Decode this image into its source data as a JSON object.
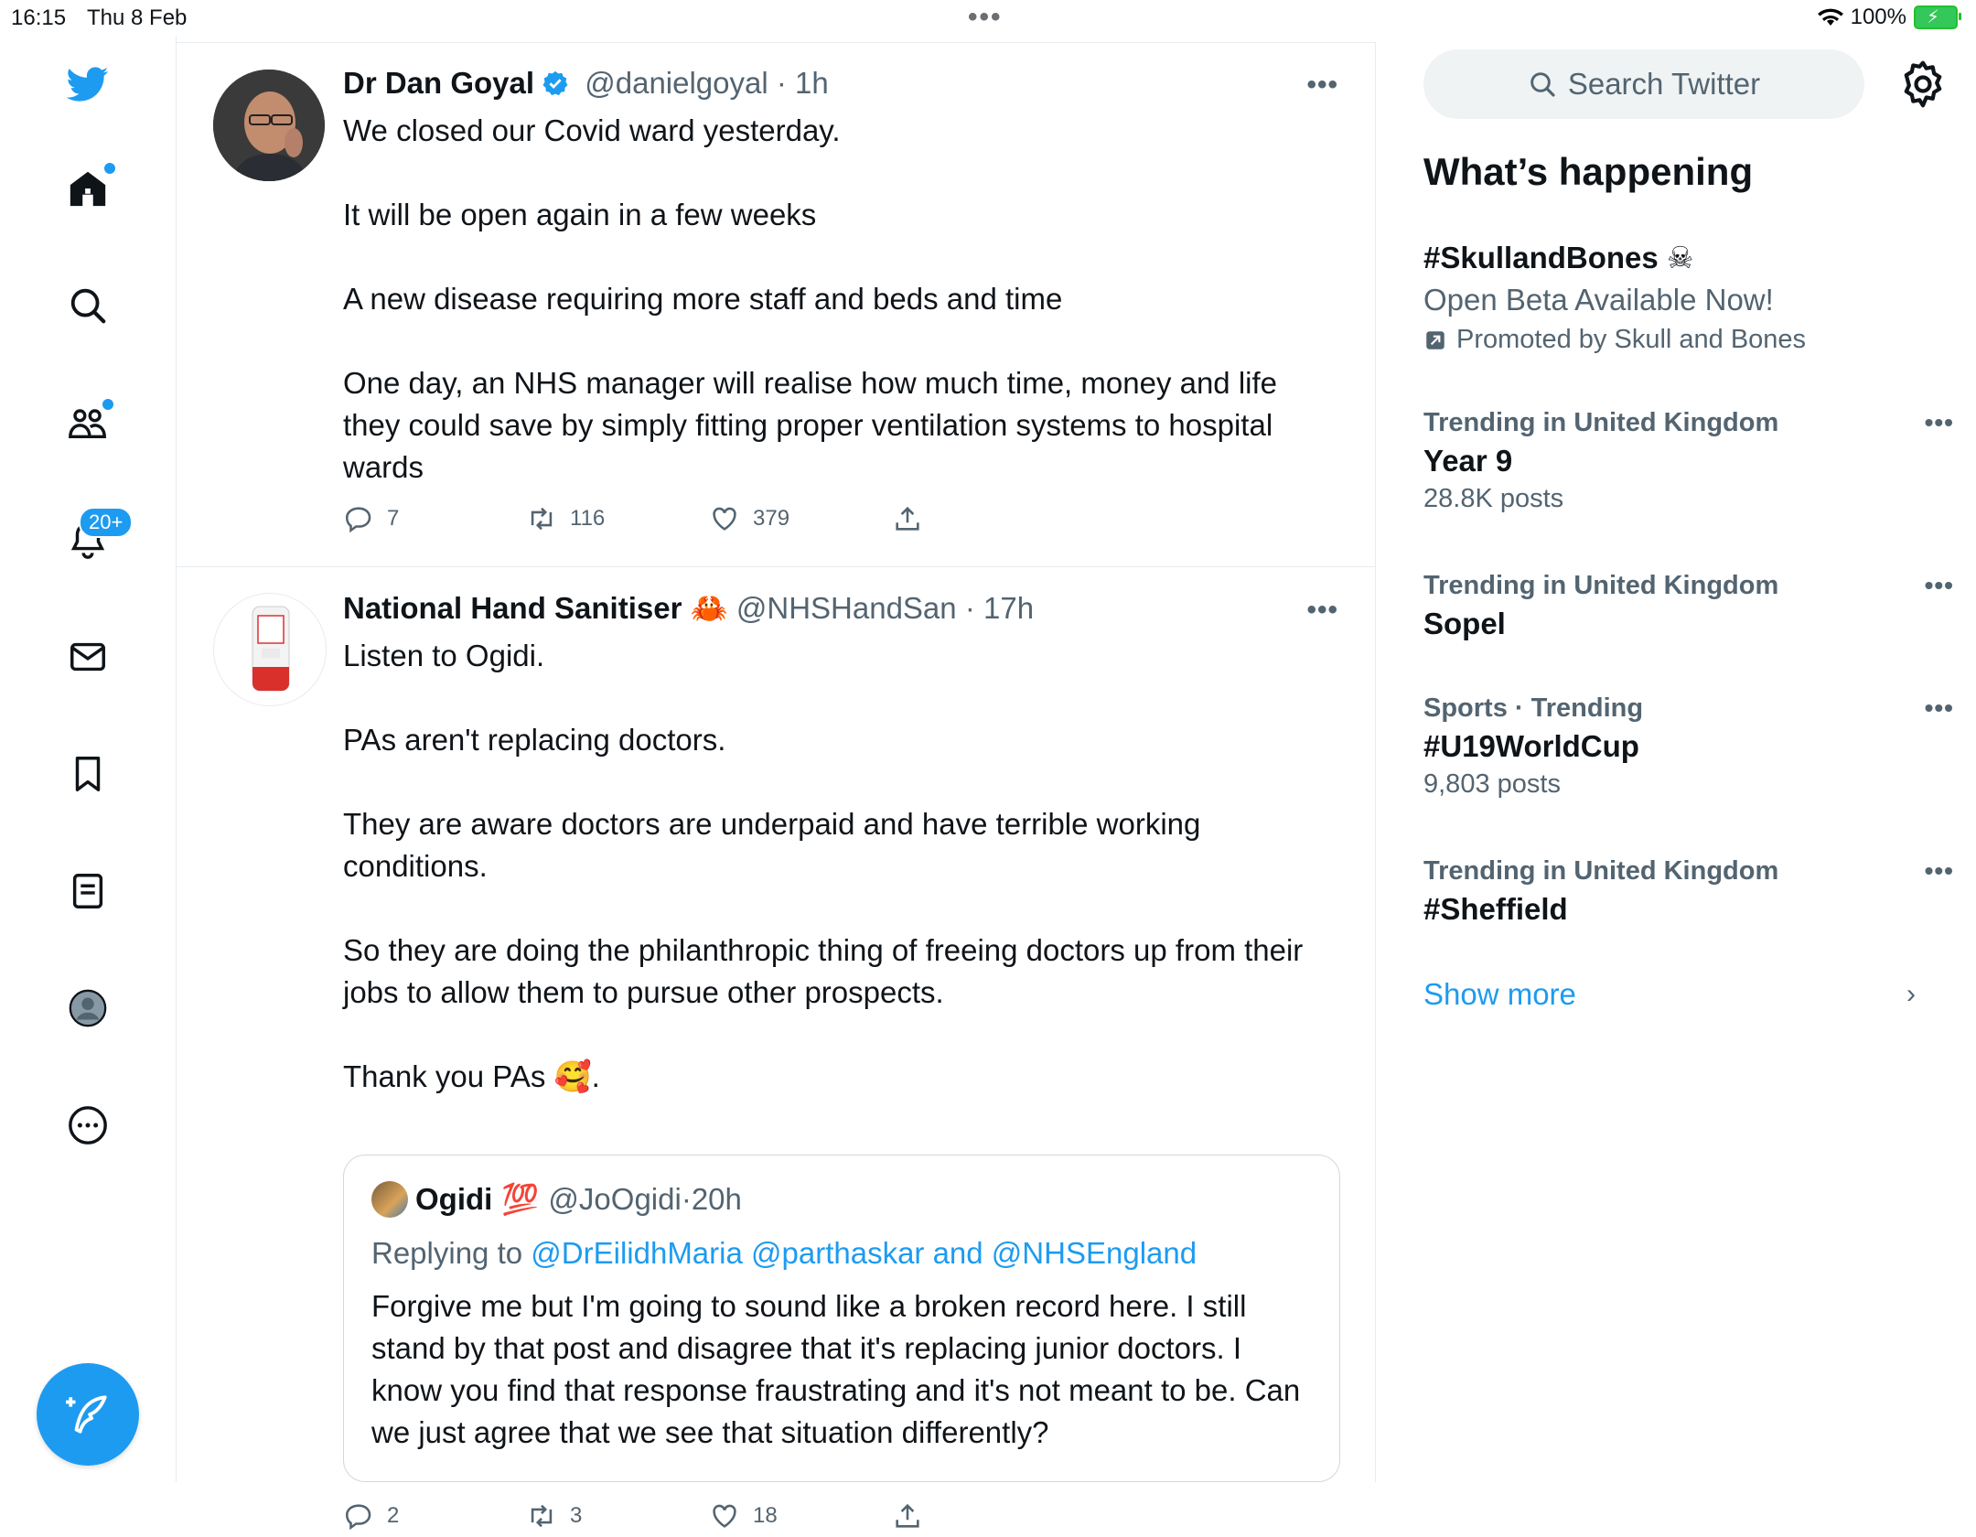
{
  "status_bar": {
    "time": "16:15",
    "date": "Thu 8 Feb",
    "battery": "100%"
  },
  "nav": {
    "notifications_badge": "20+"
  },
  "tweets": [
    {
      "name": "Dr Dan Goyal",
      "handle": "@danielgoyal",
      "time": "1h",
      "paragraphs": [
        "We closed our Covid ward yesterday.",
        "It will be open again in a few weeks",
        "A new disease requiring more staff and beds and time",
        "One day, an NHS manager will realise how much time, money and life they could save by simply fitting proper ventilation systems to hospital wards"
      ],
      "replies": "7",
      "retweets": "116",
      "likes": "379"
    },
    {
      "name": "National Hand Sanitiser",
      "name_emoji": "🦀",
      "handle": "@NHSHandSan",
      "time": "17h",
      "paragraphs": [
        "Listen to Ogidi.",
        "PAs aren't replacing doctors.",
        "They are aware doctors are underpaid and have terrible working conditions.",
        "So they are doing the philanthropic thing of freeing doctors up from their jobs to allow them to pursue other prospects.",
        "Thank you PAs 🥰."
      ],
      "quote": {
        "name": "Ogidi",
        "name_emoji": "💯",
        "handle": "@JoOgidi",
        "time": "20h",
        "replying_prefix": "Replying to",
        "replying_to": "@DrEilidhMaria @parthaskar and @NHSEngland",
        "text": "Forgive me but I'm going to sound like a broken record here. I still stand by that post and disagree that it's replacing junior doctors. I know you find that response fraustrating and it's not meant to be. Can we just agree that we see that situation differently?"
      },
      "replies": "2",
      "retweets": "3",
      "likes": "18"
    }
  ],
  "sidebar": {
    "search_placeholder": "Search Twitter",
    "section_title": "What’s happening",
    "promo": {
      "tag": "#SkullandBones",
      "tag_emoji": "☠",
      "subtitle": "Open Beta Available Now!",
      "promoted_by": "Promoted by Skull and Bones"
    },
    "trends": [
      {
        "meta": "Trending in United Kingdom",
        "name": "Year 9",
        "count": "28.8K posts"
      },
      {
        "meta": "Trending in United Kingdom",
        "name": "Sopel",
        "count": ""
      },
      {
        "meta": "Sports · Trending",
        "name": "#U19WorldCup",
        "count": "9,803 posts"
      },
      {
        "meta": "Trending in United Kingdom",
        "name": "#Sheffield",
        "count": ""
      }
    ],
    "show_more": "Show more"
  },
  "colors": {
    "accent": "#1d9bf0",
    "secondary_text": "#536471",
    "border": "#e6ecf0"
  }
}
